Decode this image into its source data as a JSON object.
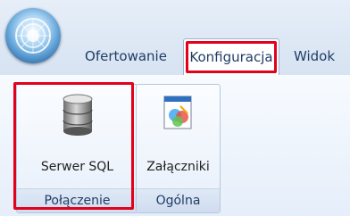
{
  "tabs": [
    {
      "label": "Ofertowanie"
    },
    {
      "label": "Konfiguracja",
      "selected": true
    },
    {
      "label": "Widok"
    }
  ],
  "groups": [
    {
      "button_label": "Serwer SQL",
      "icon": "database-icon",
      "label": "Połączenie"
    },
    {
      "button_label": "Załączniki",
      "icon": "attachments-icon",
      "label": "Ogólna"
    }
  ],
  "colors": {
    "highlight": "#e3001b",
    "tab_text": "#1f3d65"
  }
}
